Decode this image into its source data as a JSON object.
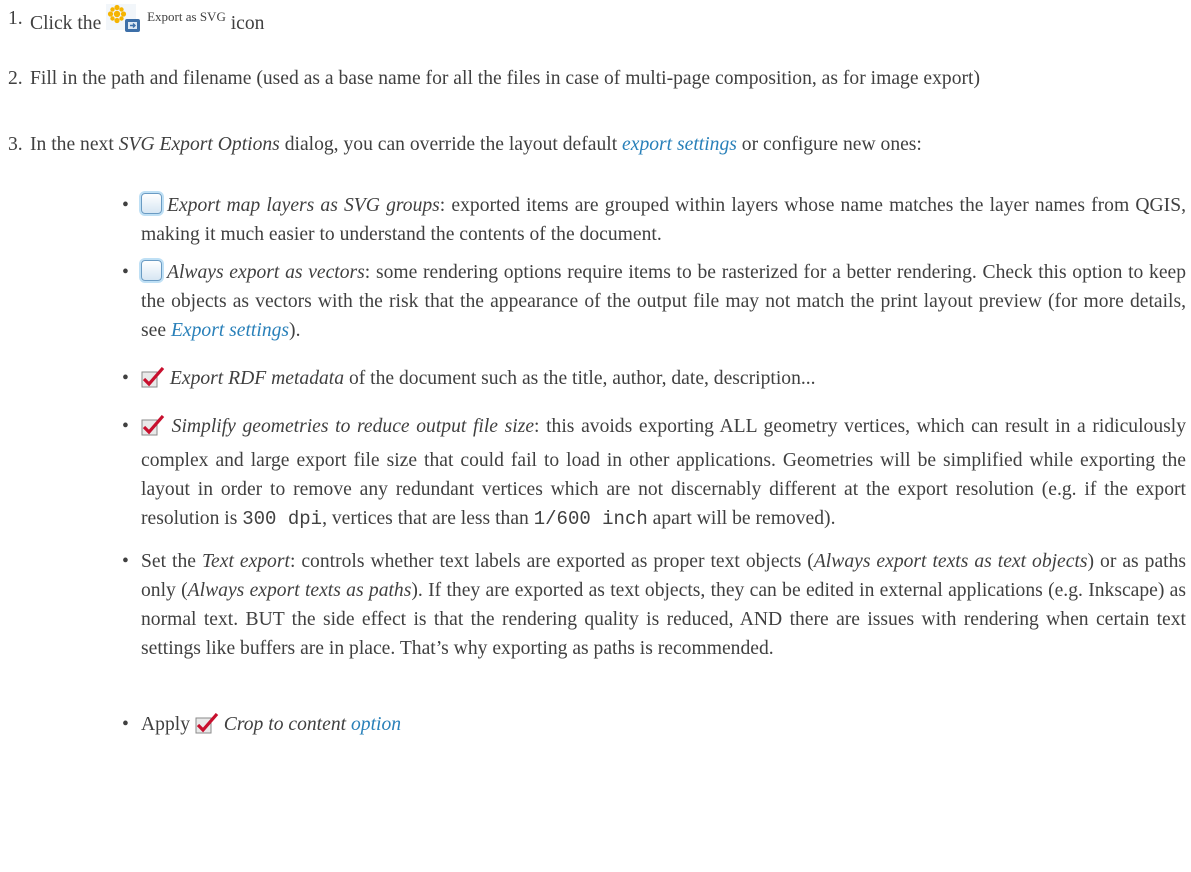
{
  "steps": [
    {
      "number": "1.",
      "text_before": "Click the",
      "icon": "export-as-svg-icon",
      "icon_label": "Export as SVG",
      "text_after": "icon"
    },
    {
      "number": "2.",
      "text": "Fill in the path and filename (used as a base name for all the files in case of multi-page composition, as for image export)"
    },
    {
      "number": "3.",
      "text_a": "In the next",
      "dialog_name": "SVG Export Options",
      "text_b": "dialog, you can override the layout default",
      "link": "export settings",
      "text_c": "or configure new ones:"
    }
  ],
  "options": [
    {
      "checkbox": "unchecked",
      "label": "Export map layers as SVG groups",
      "text": ": exported items are grouped within layers whose name matches the layer names from QGIS, making it much easier to understand the contents of the document."
    },
    {
      "checkbox": "unchecked",
      "label": "Always export as vectors",
      "text": ": some rendering options require items to be rasterized for a better rendering. Check this option to keep the objects as vectors with the risk that the appearance of the output file may not match the print layout preview (for more details, see",
      "link": "Export settings",
      "text_end": ")."
    },
    {
      "checkbox": "checked",
      "label": "Export RDF metadata",
      "text": "of the document such as the title, author, date, description..."
    },
    {
      "checkbox": "checked",
      "label": "Simplify geometries to reduce output file size",
      "text_a": ": this avoids exporting ALL geometry vertices, which can result in a ridiculously complex and large export file size that could fail to load in other applications. Geometries will be simplified while exporting the layout in order to remove any redundant vertices which are not discernably different at the export resolution (e.g. if the export resolution is",
      "code1": "300 dpi",
      "text_b": ", vertices that are less than",
      "code2": "1/600 inch",
      "text_c": "apart will be removed)."
    },
    {
      "prefix": "Set the",
      "label": "Text export",
      "text_a": ": controls whether text labels are exported as proper text objects (",
      "em1": "Always export texts as text objects",
      "text_b": ") or as paths only (",
      "em2": "Always export texts as paths",
      "text_c": "). If they are exported as text objects, they can be edited in external applications (e.g. Inkscape) as normal text. BUT the side effect is that the rendering quality is reduced, AND there are issues with rendering when certain text settings like buffers are in place. That’s why exporting as paths is recommended."
    },
    {
      "prefix": "Apply",
      "checkbox": "checked",
      "label": "Crop to content",
      "link": "option"
    }
  ],
  "bullet": "•",
  "colors": {
    "text": "#404040",
    "link": "#2980b9",
    "checkbox_border": "#6a9bc3",
    "check": "#c8102e"
  }
}
